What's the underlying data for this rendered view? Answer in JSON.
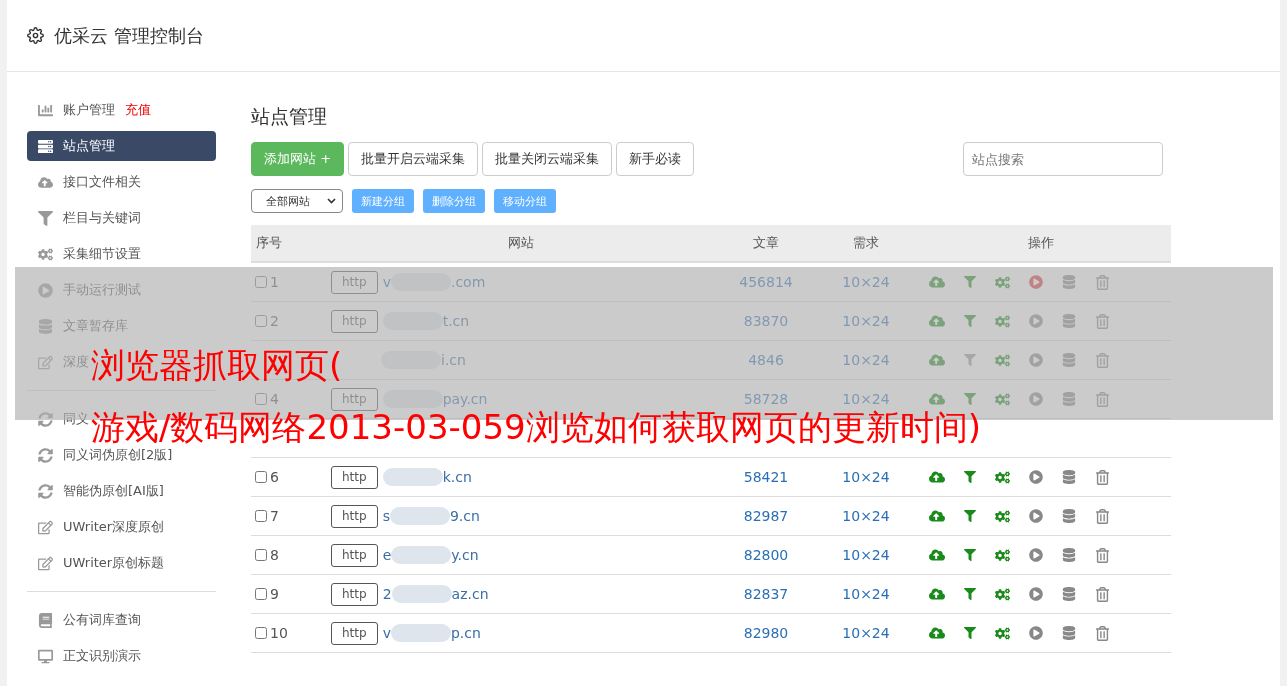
{
  "header": {
    "title": "优采云 管理控制台"
  },
  "sidebar": {
    "groups": [
      [
        {
          "label": "账户管理",
          "badge": "充值",
          "selected": false
        },
        {
          "label": "站点管理",
          "selected": true
        },
        {
          "label": "接口文件相关",
          "selected": false
        },
        {
          "label": "栏目与关键词",
          "selected": false
        },
        {
          "label": "采集细节设置",
          "selected": false
        },
        {
          "label": "手动运行测试",
          "selected": false
        },
        {
          "label": "文章暂存库",
          "selected": false
        },
        {
          "label": "深度",
          "selected": false
        }
      ],
      [
        {
          "label": "同义",
          "selected": false
        },
        {
          "label": "同义词伪原创[2版]",
          "selected": false
        },
        {
          "label": "智能伪原创[AI版]",
          "selected": false
        },
        {
          "label": "UWriter深度原创",
          "selected": false
        },
        {
          "label": "UWriter原创标题",
          "selected": false
        }
      ],
      [
        {
          "label": "公有词库查询",
          "selected": false
        },
        {
          "label": "正文识别演示",
          "selected": false
        }
      ]
    ]
  },
  "page_title": "站点管理",
  "toolbar": {
    "buttons": [
      {
        "label": "添加网站 +",
        "kind": "primary"
      },
      {
        "label": "批量开启云端采集",
        "kind": "default"
      },
      {
        "label": "批量关闭云端采集",
        "kind": "default"
      },
      {
        "label": "新手必读",
        "kind": "default"
      }
    ],
    "search": {
      "placeholder": "站点搜索"
    }
  },
  "group_bar": {
    "select": "全部网站",
    "buttons": [
      "新建分组",
      "删除分组",
      "移动分组"
    ]
  },
  "table": {
    "columns": [
      "序号",
      "网站",
      "文章",
      "需求",
      "操作"
    ],
    "rows": [
      {
        "kind": "site",
        "checked": false,
        "index": "1",
        "scheme": "http",
        "url_start": "v",
        "url_end": ".com",
        "articles": "456814",
        "demand": "10×24",
        "filter_on": true,
        "running": true
      },
      {
        "kind": "site",
        "checked": false,
        "index": "2",
        "scheme": "http",
        "url_end": "t.cn",
        "articles": "83870",
        "demand": "10×24",
        "filter_on": true,
        "running": false
      },
      {
        "kind": "site",
        "url_end": "i.cn",
        "articles": "4846",
        "demand": "10×24",
        "filter_on": false,
        "running": false
      },
      {
        "kind": "site",
        "checked": false,
        "index": "4",
        "scheme": "http",
        "url_end": "pay.cn",
        "articles": "58728",
        "demand": "10×24",
        "filter_on": true,
        "running": false
      },
      {
        "kind": "covered"
      },
      {
        "kind": "site",
        "checked": false,
        "index": "6",
        "scheme": "http",
        "url_end": "k.cn",
        "articles": "58421",
        "demand": "10×24",
        "filter_on": true,
        "running": false
      },
      {
        "kind": "site",
        "checked": false,
        "index": "7",
        "scheme": "http",
        "url_start": "s",
        "url_end": "9.cn",
        "articles": "82987",
        "demand": "10×24",
        "filter_on": true,
        "running": false
      },
      {
        "kind": "site",
        "checked": false,
        "index": "8",
        "scheme": "http",
        "url_start": "e",
        "url_end": "y.cn",
        "articles": "82800",
        "demand": "10×24",
        "filter_on": true,
        "running": false
      },
      {
        "kind": "site",
        "checked": false,
        "index": "9",
        "scheme": "http",
        "url_start": "2",
        "url_end": "az.cn",
        "articles": "82837",
        "demand": "10×24",
        "filter_on": true,
        "running": false
      },
      {
        "kind": "site",
        "checked": false,
        "index": "10",
        "scheme": "http",
        "url_start": "v",
        "url_end": "p.cn",
        "articles": "82980",
        "demand": "10×24",
        "filter_on": true,
        "running": false
      }
    ]
  },
  "overlay": {
    "lines": [
      "浏览器抓取网页(",
      "游戏/数码网络2013-03-059浏览如何获取网页的更新时间)"
    ]
  }
}
